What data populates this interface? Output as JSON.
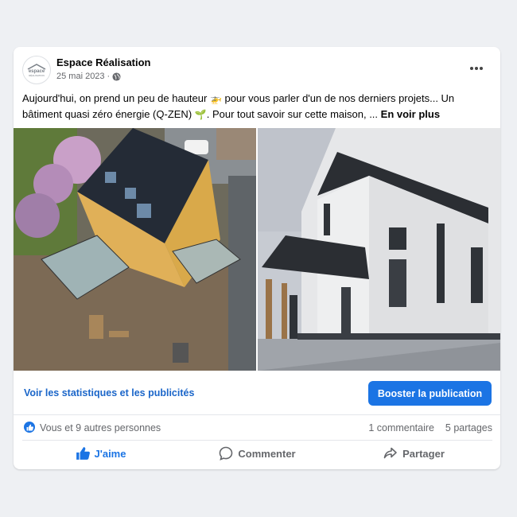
{
  "post": {
    "page_name": "Espace Réalisation",
    "avatar_text_line1": "espace",
    "avatar_text_line2": "RÉALISATION",
    "date": "25 mai 2023",
    "separator": "·",
    "text_before_emoji1": "Aujourd'hui, on prend un peu de hauteur ",
    "emoji1": "🚁",
    "text_middle": " pour vous parler d'un de nos derniers projets... Un bâtiment quasi zéro énergie (Q-ZEN) ",
    "emoji2": "🌱",
    "text_after": ". Pour tout savoir sur cette maison, ... ",
    "see_more": "En voir plus"
  },
  "insights": {
    "stats_link": "Voir les statistiques et les publicités",
    "boost_button": "Booster la publication"
  },
  "reactions": {
    "summary": "Vous et 9 autres personnes",
    "comments": "1 commentaire",
    "shares": "5 partages"
  },
  "actions": {
    "like": "J'aime",
    "comment": "Commenter",
    "share": "Partager"
  },
  "colors": {
    "accent": "#1b74e4",
    "link": "#1b66c9",
    "muted": "#65676b",
    "background": "#eef0f3"
  }
}
